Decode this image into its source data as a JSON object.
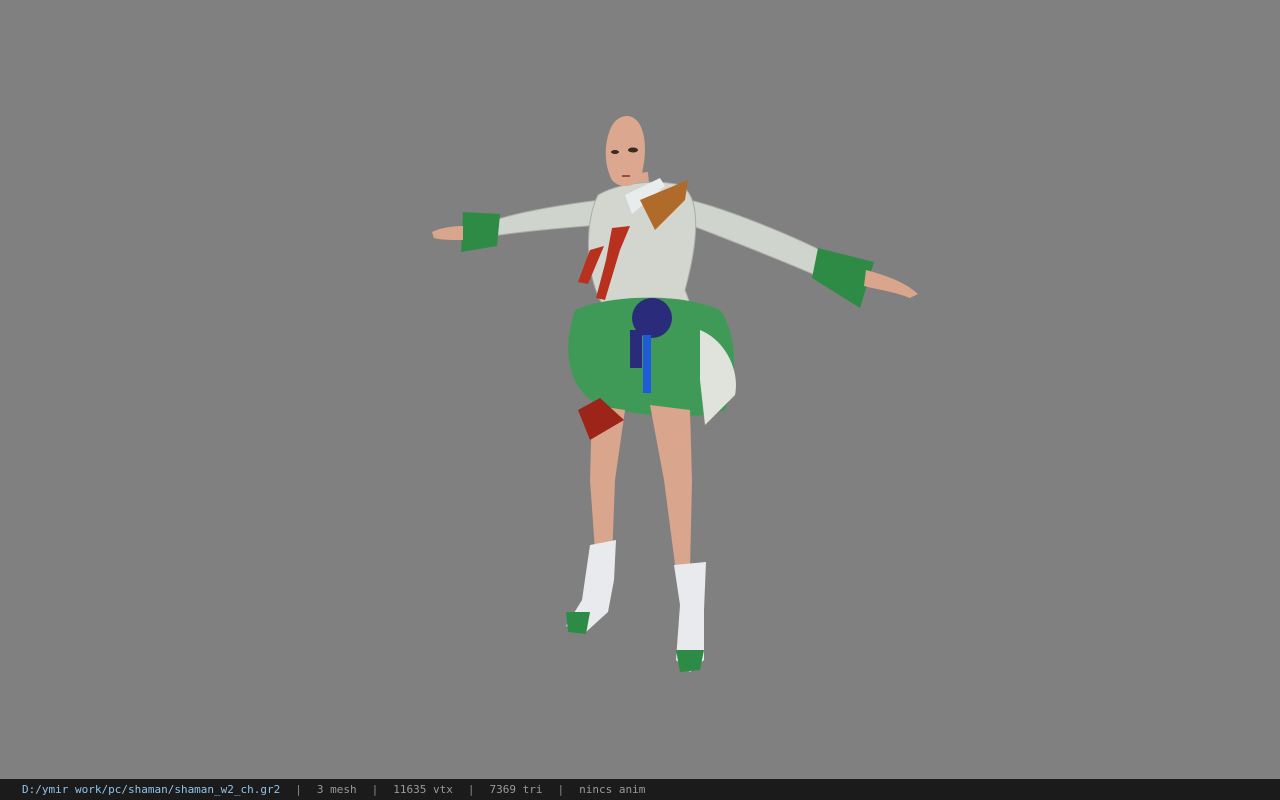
{
  "viewport": {
    "background_color": "#808080",
    "model_description_icon": "character-model-icon"
  },
  "status": {
    "file_path": "D:/ymir work/pc/shaman/shaman_w2_ch.gr2",
    "separator": "|",
    "mesh_count": "3 mesh",
    "vertex_count": "11635 vtx",
    "triangle_count": "7369 tri",
    "anim_status": "nincs anim",
    "path_color": "#8fc3ea",
    "bar_color": "#1b1b1b"
  }
}
